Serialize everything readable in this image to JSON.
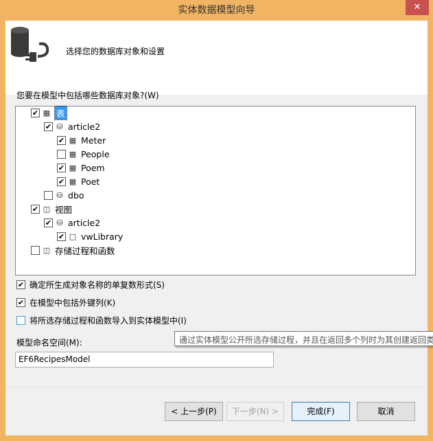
{
  "window": {
    "title": "实体数据模型向导",
    "close_icon": "close-icon"
  },
  "header": {
    "title": "选择您的数据库对象和设置",
    "icon": "database-plug-icon"
  },
  "tree_label": "您要在模型中包括哪些数据库对象?(W)",
  "tree": [
    {
      "label": "表",
      "checked": true,
      "level": 0,
      "icon": "tables-icon",
      "selected": true
    },
    {
      "label": "article2",
      "checked": true,
      "level": 1,
      "icon": "schema-icon"
    },
    {
      "label": "Meter",
      "checked": true,
      "level": 2,
      "icon": "table-icon"
    },
    {
      "label": "People",
      "checked": false,
      "level": 2,
      "icon": "table-icon"
    },
    {
      "label": "Poem",
      "checked": true,
      "level": 2,
      "icon": "table-icon"
    },
    {
      "label": "Poet",
      "checked": true,
      "level": 2,
      "icon": "table-icon"
    },
    {
      "label": "dbo",
      "checked": false,
      "level": 1,
      "icon": "schema-icon"
    },
    {
      "label": "视图",
      "checked": true,
      "level": 0,
      "icon": "views-icon"
    },
    {
      "label": "article2",
      "checked": true,
      "level": 1,
      "icon": "schema-icon"
    },
    {
      "label": "vwLibrary",
      "checked": true,
      "level": 2,
      "icon": "view-icon"
    },
    {
      "label": "存储过程和函数",
      "checked": false,
      "level": 0,
      "icon": "procedures-icon"
    }
  ],
  "options": [
    {
      "label": "确定所生成对象名称的单复数形式(S)",
      "checked": true
    },
    {
      "label": "在模型中包括外键列(K)",
      "checked": true
    },
    {
      "label": "将所选存储过程和函数导入到实体模型中(I)",
      "checked": false
    }
  ],
  "tooltip": "通过实体模型公开所选存储过程，并且在返回多个列时为其创建返回类",
  "namespace": {
    "label": "模型命名空间(M):",
    "value": "EF6RecipesModel"
  },
  "buttons": {
    "back": "< 上一步(P)",
    "next": "下一步(N) >",
    "finish": "完成(F)",
    "cancel": "取消"
  }
}
